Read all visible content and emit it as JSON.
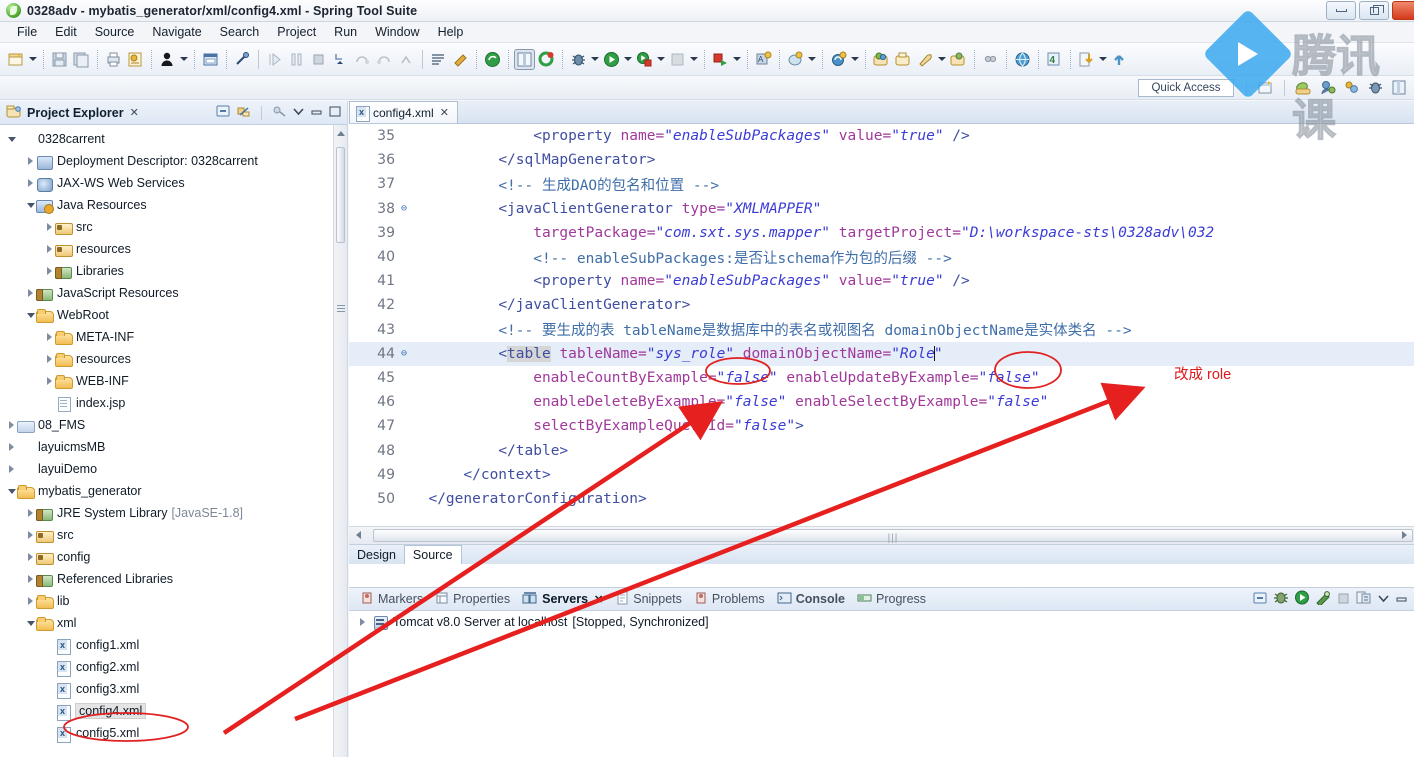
{
  "window": {
    "title": "0328adv - mybatis_generator/xml/config4.xml - Spring Tool Suite",
    "app_icon": "sts-leaf-icon",
    "buttons": {
      "minimize": "minimize-button",
      "maximize": "maximize-button",
      "close": "close-button"
    }
  },
  "menu": [
    {
      "label": "File"
    },
    {
      "label": "Edit"
    },
    {
      "label": "Source"
    },
    {
      "label": "Navigate"
    },
    {
      "label": "Search"
    },
    {
      "label": "Project"
    },
    {
      "label": "Run"
    },
    {
      "label": "Window"
    },
    {
      "label": "Help"
    }
  ],
  "quick_access": {
    "label": "Quick Access"
  },
  "watermark": {
    "text": "腾讯课",
    "logo": "play-button-logo"
  },
  "explorer": {
    "title": "Project Explorer",
    "close_glyph": "✕",
    "tools": [
      "collapse-all-icon",
      "link-with-editor-icon",
      "view-menu-icon",
      "minimize-icon",
      "maximize-icon"
    ],
    "tree": [
      {
        "indent": 0,
        "twisty": "open",
        "icon": "project",
        "label": "0328carrent"
      },
      {
        "indent": 1,
        "twisty": "closed",
        "icon": "deploy",
        "label": "Deployment Descriptor: 0328carrent"
      },
      {
        "indent": 1,
        "twisty": "closed",
        "icon": "ws",
        "label": "JAX-WS Web Services"
      },
      {
        "indent": 1,
        "twisty": "open",
        "icon": "proj",
        "label": "Java Resources"
      },
      {
        "indent": 2,
        "twisty": "closed",
        "icon": "folderp",
        "label": "src"
      },
      {
        "indent": 2,
        "twisty": "closed",
        "icon": "folderp",
        "label": "resources"
      },
      {
        "indent": 2,
        "twisty": "closed",
        "icon": "jar",
        "label": "Libraries"
      },
      {
        "indent": 1,
        "twisty": "closed",
        "icon": "jar",
        "label": "JavaScript Resources"
      },
      {
        "indent": 1,
        "twisty": "open",
        "icon": "folder",
        "label": "WebRoot"
      },
      {
        "indent": 2,
        "twisty": "closed",
        "icon": "folder",
        "label": "META-INF"
      },
      {
        "indent": 2,
        "twisty": "closed",
        "icon": "folder",
        "label": "resources"
      },
      {
        "indent": 2,
        "twisty": "closed",
        "icon": "folder",
        "label": "WEB-INF"
      },
      {
        "indent": 2,
        "twisty": "none",
        "icon": "jsp",
        "label": "index.jsp"
      },
      {
        "indent": 0,
        "twisty": "closed",
        "icon": "plainfolder",
        "label": "08_FMS"
      },
      {
        "indent": 0,
        "twisty": "closed",
        "icon": "project",
        "label": "layuicmsMB"
      },
      {
        "indent": 0,
        "twisty": "closed",
        "icon": "project",
        "label": "layuiDemo"
      },
      {
        "indent": 0,
        "twisty": "open",
        "icon": "folder",
        "label": "mybatis_generator"
      },
      {
        "indent": 1,
        "twisty": "closed",
        "icon": "jar",
        "label": "JRE System Library",
        "dim": "[JavaSE-1.8]"
      },
      {
        "indent": 1,
        "twisty": "closed",
        "icon": "folderp",
        "label": "src"
      },
      {
        "indent": 1,
        "twisty": "closed",
        "icon": "folderp",
        "label": "config"
      },
      {
        "indent": 1,
        "twisty": "closed",
        "icon": "jar",
        "label": "Referenced Libraries"
      },
      {
        "indent": 1,
        "twisty": "closed",
        "icon": "folder",
        "label": "lib"
      },
      {
        "indent": 1,
        "twisty": "open",
        "icon": "folder",
        "label": "xml"
      },
      {
        "indent": 2,
        "twisty": "none",
        "icon": "xmlf",
        "label": "config1.xml"
      },
      {
        "indent": 2,
        "twisty": "none",
        "icon": "xmlf",
        "label": "config2.xml"
      },
      {
        "indent": 2,
        "twisty": "none",
        "icon": "xmlf",
        "label": "config3.xml"
      },
      {
        "indent": 2,
        "twisty": "none",
        "icon": "xmlf",
        "label": "config4.xml",
        "selected": true
      },
      {
        "indent": 2,
        "twisty": "none",
        "icon": "xmlf",
        "label": "config5.xml"
      }
    ]
  },
  "editor": {
    "tab": {
      "label": "config4.xml",
      "close_glyph": "✕",
      "icon": "xml-file-icon"
    },
    "sub_tabs": [
      {
        "label": "Design",
        "active": false
      },
      {
        "label": "Source",
        "active": true
      }
    ],
    "lines": [
      {
        "num": "35",
        "fold": "",
        "indent": 14,
        "frags": [
          {
            "t": "<property ",
            "c": "tg"
          },
          {
            "t": "name=",
            "c": "at"
          },
          {
            "t": "\"enableSubPackages\"",
            "c": "vl"
          },
          {
            "t": " ",
            "c": "tg"
          },
          {
            "t": "value=",
            "c": "at"
          },
          {
            "t": "\"true\"",
            "c": "vl"
          },
          {
            "t": " />",
            "c": "tg"
          }
        ]
      },
      {
        "num": "36",
        "fold": "",
        "indent": 10,
        "frags": [
          {
            "t": "</sqlMapGenerator>",
            "c": "tg"
          }
        ]
      },
      {
        "num": "37",
        "fold": "",
        "indent": 10,
        "frags": [
          {
            "t": "<!-- 生成DAO的包名和位置 -->",
            "c": "cm"
          }
        ]
      },
      {
        "num": "38",
        "fold": "⊖",
        "indent": 10,
        "frags": [
          {
            "t": "<javaClientGenerator ",
            "c": "tg"
          },
          {
            "t": "type=",
            "c": "at"
          },
          {
            "t": "\"XMLMAPPER\"",
            "c": "vl"
          }
        ]
      },
      {
        "num": "39",
        "fold": "",
        "indent": 14,
        "frags": [
          {
            "t": "targetPackage=",
            "c": "at"
          },
          {
            "t": "\"com.sxt.sys.mapper\"",
            "c": "vl"
          },
          {
            "t": " ",
            "c": "tg"
          },
          {
            "t": "targetProject=",
            "c": "at"
          },
          {
            "t": "\"D:\\workspace-sts\\0328adv\\032",
            "c": "vl"
          }
        ]
      },
      {
        "num": "40",
        "fold": "",
        "indent": 14,
        "frags": [
          {
            "t": "<!-- enableSubPackages:是否让schema作为包的后缀 -->",
            "c": "cm"
          }
        ]
      },
      {
        "num": "41",
        "fold": "",
        "indent": 14,
        "frags": [
          {
            "t": "<property ",
            "c": "tg"
          },
          {
            "t": "name=",
            "c": "at"
          },
          {
            "t": "\"enableSubPackages\"",
            "c": "vl"
          },
          {
            "t": " ",
            "c": "tg"
          },
          {
            "t": "value=",
            "c": "at"
          },
          {
            "t": "\"true\"",
            "c": "vl"
          },
          {
            "t": " />",
            "c": "tg"
          }
        ]
      },
      {
        "num": "42",
        "fold": "",
        "indent": 10,
        "frags": [
          {
            "t": "</javaClientGenerator>",
            "c": "tg"
          }
        ]
      },
      {
        "num": "43",
        "fold": "",
        "indent": 10,
        "frags": [
          {
            "t": "<!-- 要生成的表 tableName是数据库中的表名或视图名 domainObjectName是实体类名 -->",
            "c": "cm"
          }
        ]
      },
      {
        "num": "44",
        "fold": "⊖",
        "indent": 10,
        "highlight": true,
        "frags": [
          {
            "t": "<",
            "c": "tg"
          },
          {
            "t": "table",
            "c": "tg hlname"
          },
          {
            "t": " ",
            "c": "tg"
          },
          {
            "t": "tableName=",
            "c": "at"
          },
          {
            "t": "\"sys_role\"",
            "c": "vl"
          },
          {
            "t": " ",
            "c": "tg"
          },
          {
            "t": "domainObjectName=",
            "c": "at"
          },
          {
            "t": "\"Role",
            "c": "vl"
          },
          {
            "t": "|",
            "c": "cursor"
          },
          {
            "t": "\"",
            "c": "vl"
          }
        ]
      },
      {
        "num": "45",
        "fold": "",
        "indent": 14,
        "frags": [
          {
            "t": "enableCountByExample=",
            "c": "at"
          },
          {
            "t": "\"false\"",
            "c": "vl"
          },
          {
            "t": " ",
            "c": "tg"
          },
          {
            "t": "enableUpdateByExample=",
            "c": "at"
          },
          {
            "t": "\"false\"",
            "c": "vl"
          }
        ]
      },
      {
        "num": "46",
        "fold": "",
        "indent": 14,
        "frags": [
          {
            "t": "enableDeleteByExample=",
            "c": "at"
          },
          {
            "t": "\"false\"",
            "c": "vl"
          },
          {
            "t": " ",
            "c": "tg"
          },
          {
            "t": "enableSelectByExample=",
            "c": "at"
          },
          {
            "t": "\"false\"",
            "c": "vl"
          }
        ]
      },
      {
        "num": "47",
        "fold": "",
        "indent": 14,
        "frags": [
          {
            "t": "selectByExampleQueryId=",
            "c": "at"
          },
          {
            "t": "\"false\"",
            "c": "vl"
          },
          {
            "t": ">",
            "c": "tg"
          }
        ]
      },
      {
        "num": "48",
        "fold": "",
        "indent": 10,
        "frags": [
          {
            "t": "</table>",
            "c": "tg"
          }
        ]
      },
      {
        "num": "49",
        "fold": "",
        "indent": 6,
        "frags": [
          {
            "t": "</context>",
            "c": "tg"
          }
        ]
      },
      {
        "num": "50",
        "fold": "",
        "indent": 2,
        "frags": [
          {
            "t": "</generatorConfiguration>",
            "c": "tg"
          }
        ]
      }
    ]
  },
  "bottom_panel": {
    "tabs": [
      {
        "label": "Markers",
        "icon": "markers-icon",
        "active": false
      },
      {
        "label": "Properties",
        "icon": "properties-icon",
        "active": false
      },
      {
        "label": "Servers",
        "icon": "servers-icon",
        "active": true,
        "close_glyph": "✕"
      },
      {
        "label": "Snippets",
        "icon": "snippets-icon",
        "active": false
      },
      {
        "label": "Problems",
        "icon": "problems-icon",
        "active": false
      },
      {
        "label": "Console",
        "icon": "console-icon",
        "active": false,
        "bold": true
      },
      {
        "label": "Progress",
        "icon": "progress-icon",
        "active": false
      }
    ],
    "tools": [
      "collapse-icon",
      "debug-icon",
      "start-icon",
      "profile-icon",
      "stop-icon",
      "publish-icon",
      "view-menu-icon",
      "minimize-icon"
    ],
    "servers": [
      {
        "name": "Tomcat v8.0 Server at localhost",
        "status": "[Stopped, Synchronized]",
        "icon": "server-icon"
      }
    ]
  },
  "annotations": {
    "note_text": "改成 role",
    "accent_color": "#e01b1b",
    "ellipses": [
      "table-name-role-ellipse",
      "domain-object-name-ellipse",
      "config4-file-ellipse"
    ],
    "arrows": [
      "arrow-to-tablename",
      "arrow-to-domainobjectname"
    ]
  }
}
